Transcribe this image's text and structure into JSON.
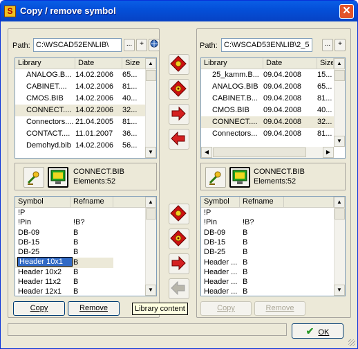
{
  "window": {
    "title": "Copy / remove symbol",
    "app_icon": "S",
    "close_glyph": "✕"
  },
  "left": {
    "path_label": "Path:",
    "path": "C:\\WSCAD52EN\\LIB\\",
    "path_buttons": [
      "...",
      "+",
      "⊕"
    ],
    "columns": [
      "Library",
      "Date",
      "Size"
    ],
    "files": [
      {
        "name": "ANALOG.B...",
        "date": "14.02.2006",
        "size": "65..."
      },
      {
        "name": "CABINET....",
        "date": "14.02.2006",
        "size": "81..."
      },
      {
        "name": "CMOS.BIB",
        "date": "14.02.2006",
        "size": "40..."
      },
      {
        "name": "CONNECT....",
        "date": "14.02.2006",
        "size": "32..."
      },
      {
        "name": "Connectors....",
        "date": "21.04.2005",
        "size": "81..."
      },
      {
        "name": "CONTACT....",
        "date": "11.01.2007",
        "size": "36..."
      },
      {
        "name": "Demohyd.bib",
        "date": "14.02.2006",
        "size": "56..."
      }
    ],
    "info_name": "CONNECT.BIB",
    "info_elements": "Elements:52",
    "sym_columns": [
      "Symbol",
      "Refname"
    ],
    "symbols": [
      {
        "symbol": "!P",
        "ref": ""
      },
      {
        "symbol": "!Pin",
        "ref": "!B?"
      },
      {
        "symbol": "DB-09",
        "ref": "B"
      },
      {
        "symbol": "DB-15",
        "ref": "B"
      },
      {
        "symbol": "DB-25",
        "ref": "B"
      },
      {
        "symbol": "Header 10x1",
        "ref": "B"
      },
      {
        "symbol": "Header 10x2",
        "ref": "B"
      },
      {
        "symbol": "Header 11x2",
        "ref": "B"
      },
      {
        "symbol": "Header 12x1",
        "ref": "B"
      }
    ],
    "copy_label": "Copy",
    "remove_label": "Remove"
  },
  "right": {
    "path_label": "Path:",
    "path": "C:\\WSCAD53EN\\LIB\\2_5",
    "path_buttons": [
      "...",
      "+"
    ],
    "columns": [
      "Library",
      "Date",
      "Size"
    ],
    "files": [
      {
        "name": "25_kamm.B...",
        "date": "09.04.2008",
        "size": "15..."
      },
      {
        "name": "ANALOG.BIB",
        "date": "09.04.2008",
        "size": "65..."
      },
      {
        "name": "CABINET.B...",
        "date": "09.04.2008",
        "size": "81..."
      },
      {
        "name": "CMOS.BIB",
        "date": "09.04.2008",
        "size": "40..."
      },
      {
        "name": "CONNECT....",
        "date": "09.04.2008",
        "size": "32..."
      },
      {
        "name": "Connectors...",
        "date": "09.04.2008",
        "size": "81..."
      }
    ],
    "info_name": "CONNECT.BIB",
    "info_elements": "Elements:52",
    "sym_columns": [
      "Symbol",
      "Refname"
    ],
    "symbols": [
      {
        "symbol": "!P",
        "ref": ""
      },
      {
        "symbol": "!Pin",
        "ref": "!B?"
      },
      {
        "symbol": "DB-09",
        "ref": "B"
      },
      {
        "symbol": "DB-15",
        "ref": "B"
      },
      {
        "symbol": "DB-25",
        "ref": "B"
      },
      {
        "symbol": "Header ...",
        "ref": "B"
      },
      {
        "symbol": "Header ...",
        "ref": "B"
      },
      {
        "symbol": "Header ...",
        "ref": "B"
      },
      {
        "symbol": "Header ...",
        "ref": "B"
      }
    ],
    "copy_label": "Copy",
    "remove_label": "Remove"
  },
  "tooltip": "Library content",
  "ok_label": "OK",
  "colors": {
    "selected_row": "#ece9d8",
    "edit_outline": "#316ac5",
    "arrow_red": "#d42020",
    "diamond_red": "#cc1010"
  }
}
